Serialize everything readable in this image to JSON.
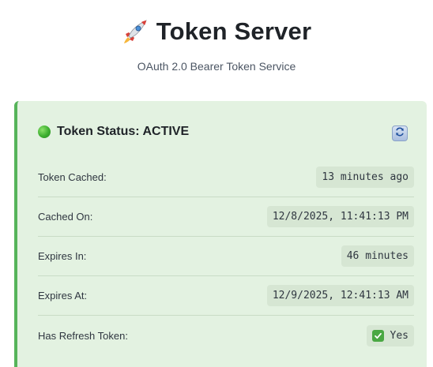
{
  "header": {
    "title": "Token Server",
    "subtitle": "OAuth 2.0 Bearer Token Service",
    "logo_icon": "rocket-icon"
  },
  "status_card": {
    "status_label": "Token Status: ACTIVE",
    "status_color": "#3cae2f",
    "accent_color": "#56b45a",
    "background_color": "#e3f2e1",
    "refresh_icon": "refresh-icon",
    "rows": [
      {
        "label": "Token Cached:",
        "value": "13 minutes ago"
      },
      {
        "label": "Cached On:",
        "value": "12/8/2025, 11:41:13 PM"
      },
      {
        "label": "Expires In:",
        "value": "46 minutes"
      },
      {
        "label": "Expires At:",
        "value": "12/9/2025, 12:41:13 AM"
      },
      {
        "label": "Has Refresh Token:",
        "value": "Yes",
        "icon": "checkmark-icon"
      }
    ]
  }
}
